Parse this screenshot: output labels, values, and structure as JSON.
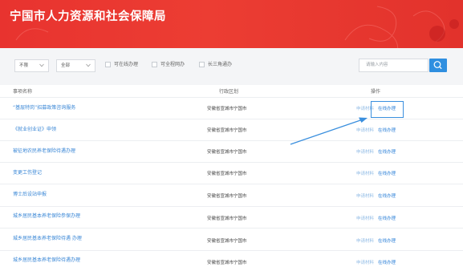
{
  "header": {
    "title": "宁国市人力资源和社会保障局"
  },
  "filters": {
    "select1": "不限",
    "select2": "全部",
    "checkboxes": [
      "可在线办理",
      "可全程网办",
      "长三角通办"
    ],
    "search_placeholder": "请输入内容"
  },
  "table": {
    "headers": {
      "name": "事项名称",
      "region": "行政区划",
      "action": "操作"
    },
    "rows": [
      {
        "name": "“基层特岗”招募政策咨询服务",
        "region": "安徽省宣城市宁国市",
        "a1": "申请材料",
        "a2": "在线办理"
      },
      {
        "name": "《就业创业证》申领",
        "region": "安徽省宣城市宁国市",
        "a1": "申请材料",
        "a2": "在线办理"
      },
      {
        "name": "被征地农民养老保险待遇办理",
        "region": "安徽省宣城市宁国市",
        "a1": "申请材料",
        "a2": "在线办理"
      },
      {
        "name": "变更工伤登记",
        "region": "安徽省宣城市宁国市",
        "a1": "申请材料",
        "a2": "在线办理"
      },
      {
        "name": "博士后设站申报",
        "region": "安徽省宣城市宁国市",
        "a1": "申请材料",
        "a2": "在线办理"
      },
      {
        "name": "城乡居民基本养老保险参保办理",
        "region": "安徽省宣城市宁国市",
        "a1": "申请材料",
        "a2": "在线办理"
      },
      {
        "name": "城乡居民基本养老保险待遇 办理",
        "region": "安徽省宣城市宁国市",
        "a1": "申请材料",
        "a2": "在线办理"
      },
      {
        "name": "城乡居民基本养老保险待遇办理",
        "region": "安徽省宣城市宁国市",
        "a1": "申请材料",
        "a2": "在线办理"
      }
    ]
  },
  "colors": {
    "banner": "#e8332f",
    "link": "#3a87d6",
    "accent": "#2f8fe0"
  },
  "icons": [
    "chevron-down-icon",
    "search-icon",
    "arrow-annotation-icon"
  ]
}
